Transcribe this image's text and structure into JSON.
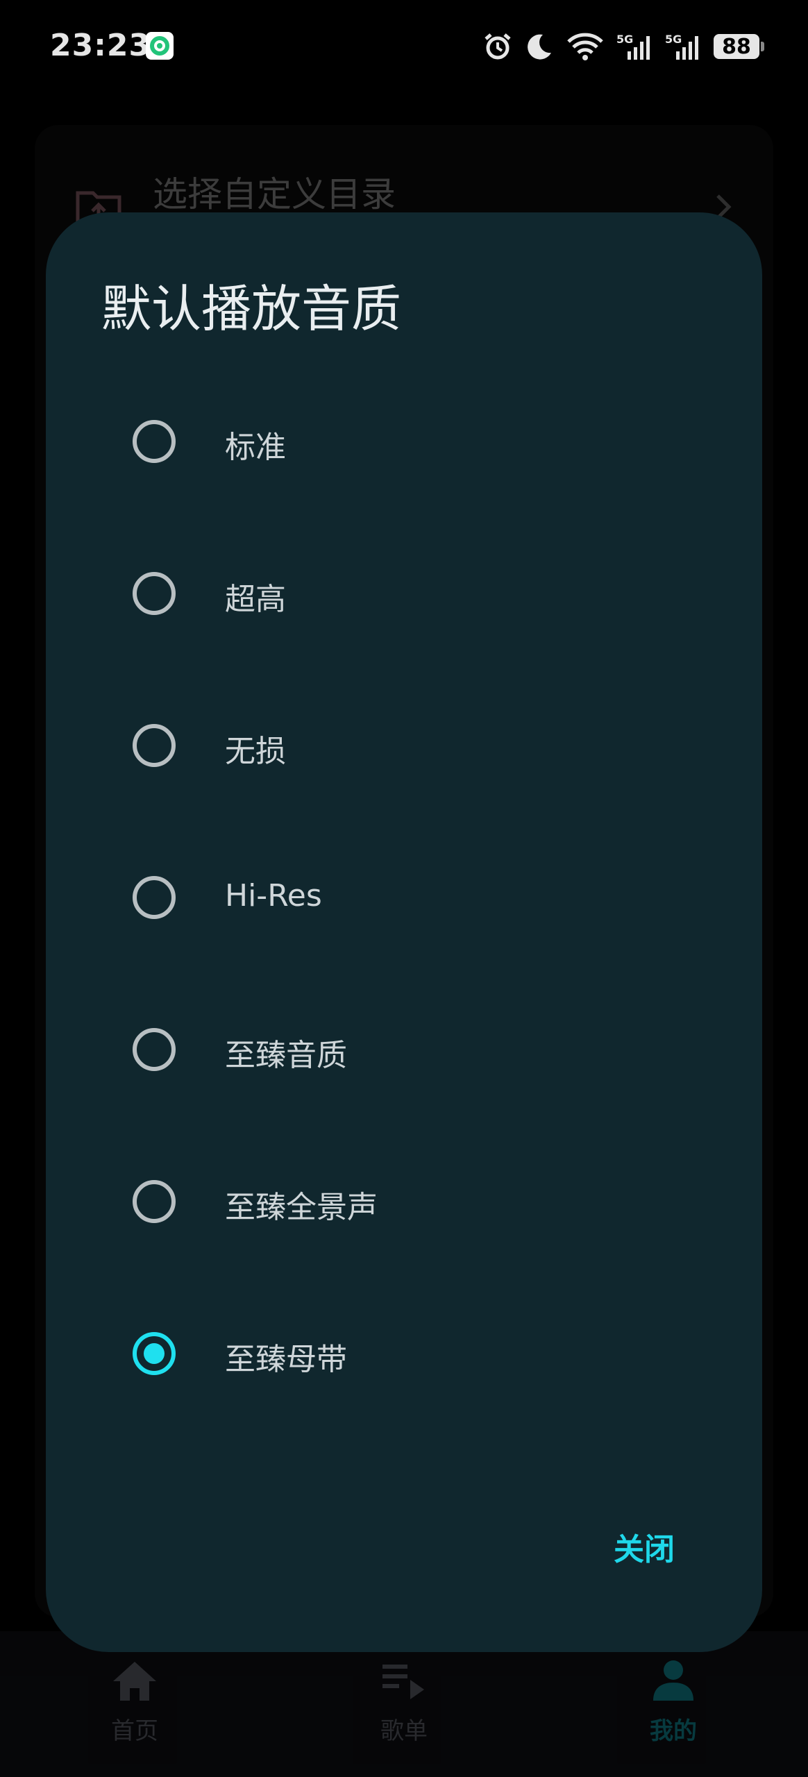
{
  "status_bar": {
    "time": "23:23",
    "battery": "88",
    "network_1": "5G",
    "network_2": "5G"
  },
  "background": {
    "row_label": "选择自定义目录"
  },
  "dialog": {
    "title": "默认播放音质",
    "options": [
      {
        "label": "标准",
        "selected": false
      },
      {
        "label": "超高",
        "selected": false
      },
      {
        "label": "无损",
        "selected": false
      },
      {
        "label": "Hi-Res",
        "selected": false
      },
      {
        "label": "至臻音质",
        "selected": false
      },
      {
        "label": "至臻全景声",
        "selected": false
      },
      {
        "label": "至臻母带",
        "selected": true
      }
    ],
    "close_label": "关闭"
  },
  "bottom_nav": {
    "items": [
      {
        "label": "首页",
        "icon": "home-icon",
        "active": false
      },
      {
        "label": "歌单",
        "icon": "playlist-icon",
        "active": false
      },
      {
        "label": "我的",
        "icon": "person-icon",
        "active": true
      }
    ]
  },
  "colors": {
    "accent": "#1fe0ef",
    "dialog_bg": "#10272e",
    "nav_active": "#0d6b73"
  }
}
